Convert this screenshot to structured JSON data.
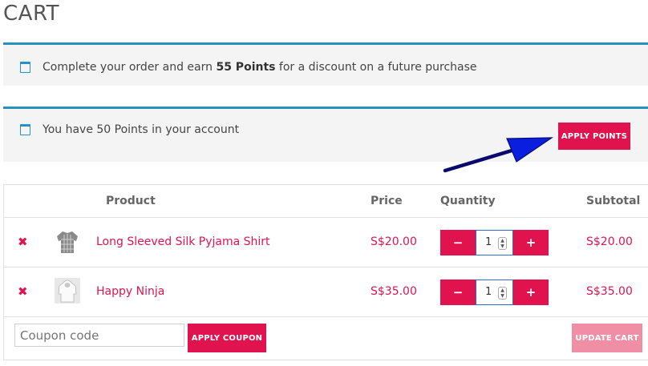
{
  "page": {
    "title": "CART"
  },
  "notices": {
    "earn": {
      "prefix": "Complete your order and earn ",
      "points": "55 Points",
      "suffix": " for a discount on a future purchase"
    },
    "balance": {
      "text": "You have 50 Points in your account",
      "button_label": "APPLY POINTS"
    }
  },
  "table": {
    "headers": {
      "product": "Product",
      "price": "Price",
      "quantity": "Quantity",
      "subtotal": "Subtotal"
    },
    "rows": [
      {
        "remove": "✖",
        "thumb_icon": "shirt-icon",
        "name": "Long Sleeved Silk Pyjama Shirt",
        "price": "S$20.00",
        "qty": "1",
        "subtotal": "S$20.00"
      },
      {
        "remove": "✖",
        "thumb_icon": "hoodie-icon",
        "name": "Happy Ninja",
        "price": "S$35.00",
        "qty": "1",
        "subtotal": "S$35.00"
      }
    ],
    "qty_minus": "−",
    "qty_plus": "+"
  },
  "coupon": {
    "placeholder": "Coupon code",
    "apply_label": "APPLY COUPON"
  },
  "update_label": "UPDATE CART",
  "colors": {
    "accent": "#e0134f",
    "notice_border": "#2a8fc4",
    "update_disabled": "#f08ea6"
  }
}
